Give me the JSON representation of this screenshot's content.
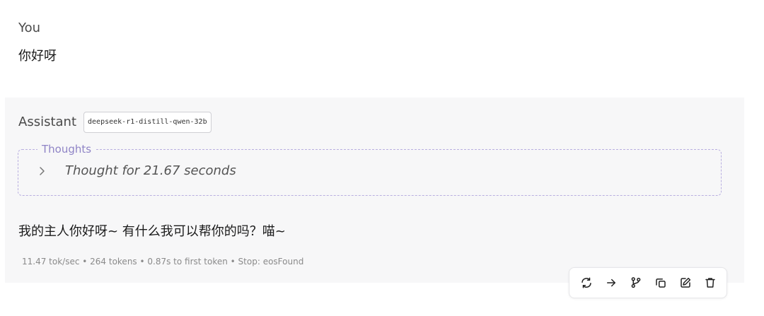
{
  "user": {
    "role": "You",
    "message": "你好呀"
  },
  "assistant": {
    "role": "Assistant",
    "model": "deepseek-r1-distill-qwen-32b",
    "thoughts": {
      "legend": "Thoughts",
      "summary": "Thought for 21.67 seconds",
      "icon": "chevron-right-icon"
    },
    "message": "我的主人你好呀~ 有什么我可以帮你的吗？喵~",
    "stats": "11.47 tok/sec • 264 tokens • 0.87s to first token • Stop: eosFound"
  },
  "actions": [
    {
      "icon": "regenerate-icon"
    },
    {
      "icon": "continue-arrow-icon"
    },
    {
      "icon": "branch-icon"
    },
    {
      "icon": "copy-icon"
    },
    {
      "icon": "edit-icon"
    },
    {
      "icon": "delete-icon"
    }
  ],
  "colors": {
    "assistant_bg": "#f7f7f8",
    "thoughts_accent": "#8f84c6",
    "thoughts_border": "#b8aee0"
  }
}
